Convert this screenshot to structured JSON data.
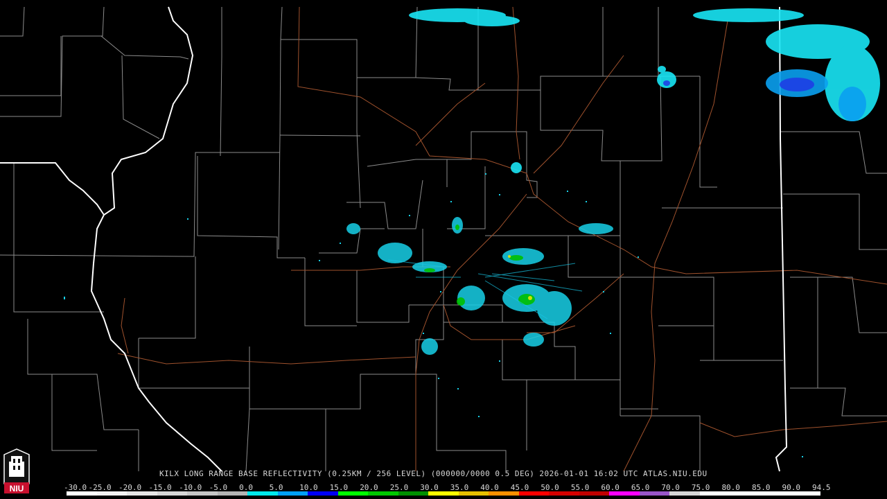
{
  "header": {
    "info_line": "KILX LONG RANGE BASE REFLECTIVITY (0.25KM / 256 LEVEL) (000000/0000 0.5 DEG) 2026-01-01 16:02 UTC  ATLAS.NIU.EDU"
  },
  "color_scale": {
    "labels": [
      "-30.0",
      "-25.0",
      "-20.0",
      "-15.0",
      "-10.0",
      "-5.0",
      "0.0",
      "5.0",
      "10.0",
      "15.0",
      "20.0",
      "25.0",
      "30.0",
      "35.0",
      "40.0",
      "45.0",
      "50.0",
      "55.0",
      "60.0",
      "65.0",
      "70.0",
      "75.0",
      "80.0",
      "85.0",
      "90.0",
      "94.5"
    ],
    "colors": [
      "#ffffff",
      "#f4f4f4",
      "#e6e6e6",
      "#d6d6d6",
      "#c6c6c6",
      "#b4b4b4",
      "#00e8ec",
      "#01a0f6",
      "#0000f6",
      "#00ff00",
      "#00c800",
      "#009000",
      "#ffff00",
      "#e7c000",
      "#ff9000",
      "#ff0000",
      "#d60000",
      "#c00000",
      "#ff00ff",
      "#9955c9",
      "#d6d6d6",
      "#ffffff",
      "#ffffff",
      "#ffffff",
      "#ffffff"
    ]
  },
  "logo": {
    "text": "NIU",
    "colors": {
      "shield": "#c8102e",
      "outline": "#ffffff"
    }
  },
  "map": {
    "radar_site": "KILX",
    "background": "#000000",
    "county_line_color": "#9a9a9a",
    "state_line_color": "#ffffff",
    "road_color": "#a0522d"
  }
}
